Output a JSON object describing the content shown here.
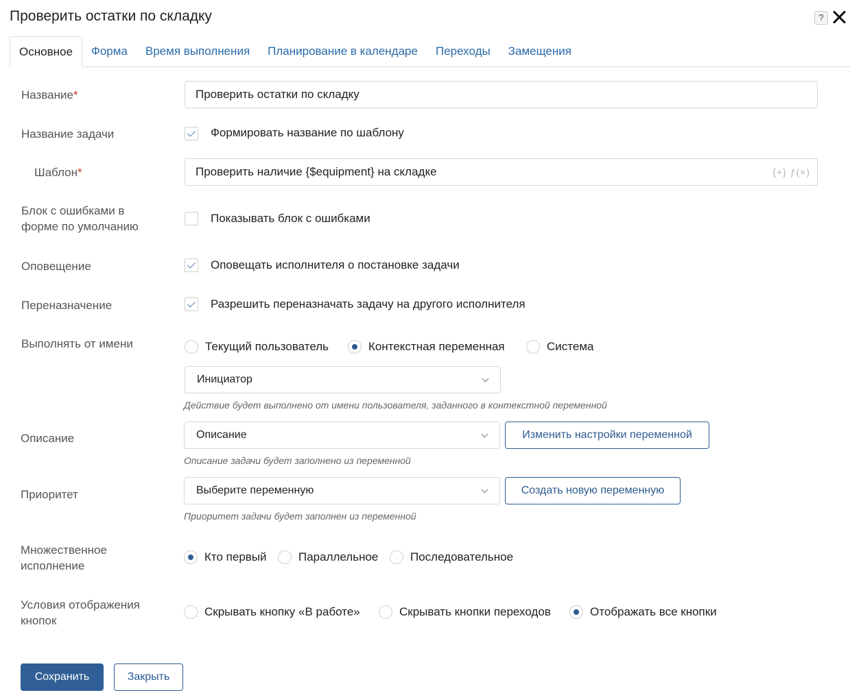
{
  "dialog": {
    "title": "Проверить остатки по складку",
    "help_label": "?"
  },
  "tabs": [
    {
      "label": "Основное"
    },
    {
      "label": "Форма"
    },
    {
      "label": "Время выполнения"
    },
    {
      "label": "Планирование в календаре"
    },
    {
      "label": "Переходы"
    },
    {
      "label": "Замещения"
    }
  ],
  "fields": {
    "name": {
      "label": "Название",
      "required_mark": "*",
      "value": "Проверить остатки по складку"
    },
    "task_name": {
      "label": "Название задачи",
      "checkbox_label": "Формировать название по шаблону",
      "checked": true
    },
    "template": {
      "label": "Шаблон",
      "required_mark": "*",
      "value": "Проверить наличие {$equipment} на складке",
      "icons": "{+} ƒ(×)"
    },
    "error_block": {
      "label_line1": "Блок с ошибками в",
      "label_line2": "форме по умолчанию",
      "checkbox_label": "Показывать блок с ошибками",
      "checked": false
    },
    "notification": {
      "label": "Оповещение",
      "checkbox_label": "Оповещать исполнителя о постановке задачи",
      "checked": true
    },
    "reassign": {
      "label": "Переназначение",
      "checkbox_label": "Разрешить переназначать задачу на другого исполнителя",
      "checked": true
    },
    "execute_as": {
      "label": "Выполнять от имени",
      "options": [
        "Текущий пользователь",
        "Контекстная переменная",
        "Система"
      ],
      "selected": "Контекстная переменная",
      "select_value": "Инициатор",
      "hint": "Действие будет выполнено от имени пользователя, заданного в контекстной переменной"
    },
    "description": {
      "label": "Описание",
      "select_value": "Описание",
      "button_label": "Изменить настройки переменной",
      "hint": "Описание задачи будет заполнено из переменной"
    },
    "priority": {
      "label": "Приоритет",
      "select_value": "Выберите переменную",
      "button_label": "Создать новую переменную",
      "hint": "Приоритет задачи будет заполнен из переменной"
    },
    "multiple": {
      "label_line1": "Множественное",
      "label_line2": "исполнение",
      "options": [
        "Кто первый",
        "Параллельное",
        "Последовательное"
      ],
      "selected": "Кто первый"
    },
    "buttons_display": {
      "label_line1": "Условия отображения",
      "label_line2": "кнопок",
      "options": [
        "Скрывать кнопку «В работе»",
        "Скрывать кнопки переходов",
        "Отображать все кнопки"
      ],
      "selected": "Отображать все кнопки"
    }
  },
  "footer": {
    "save_label": "Сохранить",
    "close_label": "Закрыть"
  }
}
